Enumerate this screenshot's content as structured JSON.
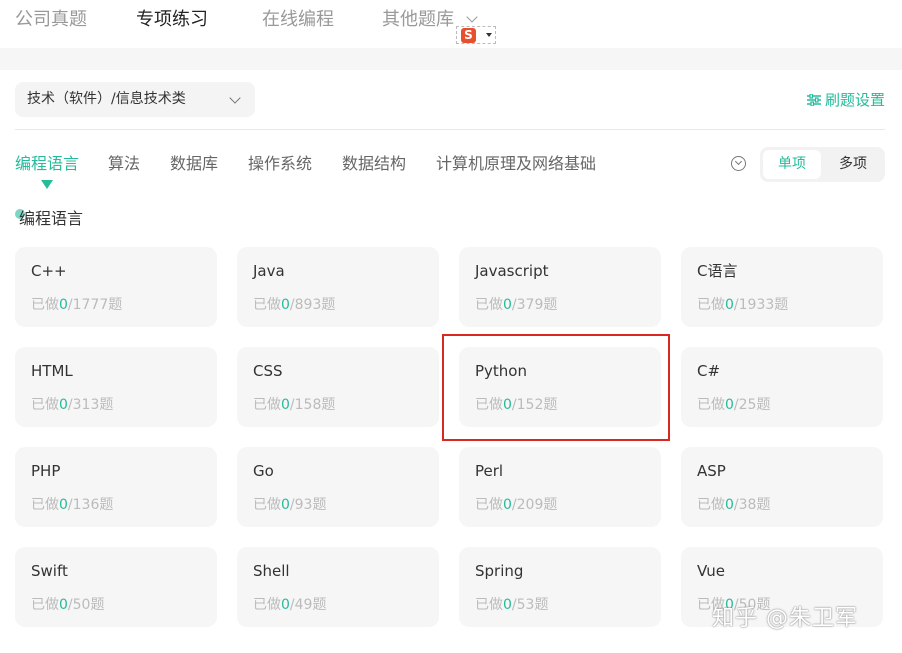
{
  "top_tabs": [
    {
      "label": "公司真题",
      "active": false
    },
    {
      "label": "专项练习",
      "active": true
    },
    {
      "label": "在线编程",
      "active": false
    },
    {
      "label": "其他题库",
      "active": false
    }
  ],
  "category_select": {
    "value": "技术（软件）/信息技术类"
  },
  "settings": {
    "label": "刷题设置"
  },
  "sub_tabs": [
    {
      "label": "编程语言",
      "active": true
    },
    {
      "label": "算法",
      "active": false
    },
    {
      "label": "数据库",
      "active": false
    },
    {
      "label": "操作系统",
      "active": false
    },
    {
      "label": "数据结构",
      "active": false
    },
    {
      "label": "计算机原理及网络基础",
      "active": false
    }
  ],
  "mode": {
    "single": "单项",
    "multi": "多项",
    "selected": "single"
  },
  "section_title": "编程语言",
  "progress_prefix": "已做",
  "progress_suffix": "题",
  "cards": [
    {
      "name": "C++",
      "done": "0",
      "total": "/1777"
    },
    {
      "name": "Java",
      "done": "0",
      "total": "/893"
    },
    {
      "name": "Javascript",
      "done": "0",
      "total": "/379"
    },
    {
      "name": "C语言",
      "done": "0",
      "total": "/1933"
    },
    {
      "name": "HTML",
      "done": "0",
      "total": "/313"
    },
    {
      "name": "CSS",
      "done": "0",
      "total": "/158"
    },
    {
      "name": "Python",
      "done": "0",
      "total": "/152"
    },
    {
      "name": "C#",
      "done": "0",
      "total": "/25"
    },
    {
      "name": "PHP",
      "done": "0",
      "total": "/136"
    },
    {
      "name": "Go",
      "done": "0",
      "total": "/93"
    },
    {
      "name": "Perl",
      "done": "0",
      "total": "/209"
    },
    {
      "name": "ASP",
      "done": "0",
      "total": "/38"
    },
    {
      "name": "Swift",
      "done": "0",
      "total": "/50"
    },
    {
      "name": "Shell",
      "done": "0",
      "total": "/49"
    },
    {
      "name": "Spring",
      "done": "0",
      "total": "/53"
    },
    {
      "name": "Vue",
      "done": "0",
      "total": "/50"
    }
  ],
  "highlighted_card": "Python",
  "watermark": "知乎 @朱卫军",
  "colors": {
    "accent": "#25bb9b",
    "highlight": "#d9281f",
    "card_bg": "#f6f6f7"
  }
}
